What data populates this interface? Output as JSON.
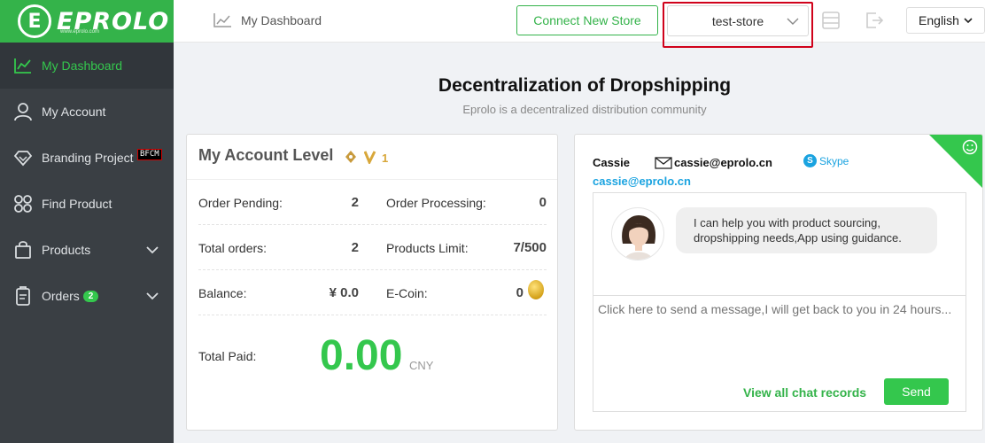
{
  "brand": {
    "name": "EPROLO",
    "mark": "E",
    "tagline": "www.eprolo.com",
    "accent": "#34b34a"
  },
  "sidebar": {
    "items": [
      {
        "label": "My Dashboard",
        "icon": "chart-line-icon"
      },
      {
        "label": "My Account",
        "icon": "user-icon"
      },
      {
        "label": "Branding Project",
        "icon": "diamond-icon",
        "badge": "BFCM"
      },
      {
        "label": "Find Product",
        "icon": "grid-icon"
      },
      {
        "label": "Products",
        "icon": "bag-icon"
      },
      {
        "label": "Orders",
        "icon": "clipboard-icon",
        "count": "2"
      }
    ]
  },
  "header": {
    "breadcrumb": "My Dashboard",
    "connect_label": "Connect New Store",
    "store": "test-store",
    "language": "English"
  },
  "main": {
    "title": "Decentralization of Dropshipping",
    "subtitle": "Eprolo is a decentralized distribution community"
  },
  "account": {
    "title": "My Account Level",
    "level": "1",
    "rows": [
      {
        "l1": "Order Pending:",
        "v1": "2",
        "l2": "Order Processing:",
        "v2": "0"
      },
      {
        "l1": "Total orders:",
        "v1": "2",
        "l2": "Products Limit:",
        "v2": "7/500"
      },
      {
        "l1": "Balance:",
        "v1": "¥ 0.0",
        "l2": "E-Coin:",
        "v2": "0"
      }
    ],
    "total_label": "Total Paid:",
    "total_value": "0.00",
    "total_unit": "CNY"
  },
  "chat": {
    "agent": "Cassie",
    "email": "cassie@eprolo.cn",
    "skype": "Skype",
    "link": "cassie@eprolo.cn",
    "message": "I can help you with product sourcing, dropshipping needs,App using guidance.",
    "placeholder": "Click here to send a message,I will get back to you in 24 hours...",
    "view_records": "View all chat records",
    "send": "Send"
  }
}
